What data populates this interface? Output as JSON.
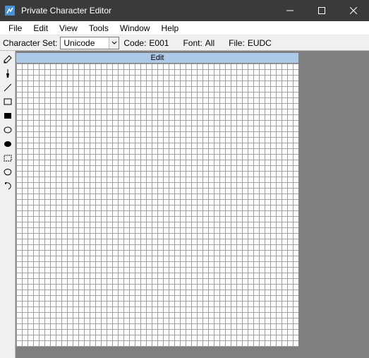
{
  "titlebar": {
    "app_title": "Private Character Editor"
  },
  "menubar": {
    "items": [
      "File",
      "Edit",
      "View",
      "Tools",
      "Window",
      "Help"
    ]
  },
  "infobar": {
    "charset_label": "Character Set:",
    "charset_value": "Unicode",
    "code_label": "Code:",
    "code_value": "E001",
    "font_label": "Font:",
    "font_value": "All",
    "file_label": "File:",
    "file_value": "EUDC"
  },
  "panel": {
    "edit_title": "Edit"
  },
  "tools": {
    "pencil": "pencil",
    "brush": "brush",
    "line": "line",
    "rect_outline": "hollow-rectangle",
    "rect_fill": "filled-rectangle",
    "ellipse_outline": "hollow-ellipse",
    "ellipse_fill": "filled-ellipse",
    "rect_select": "rectangular-selection",
    "free_select": "freeform-selection",
    "eraser": "eraser"
  }
}
